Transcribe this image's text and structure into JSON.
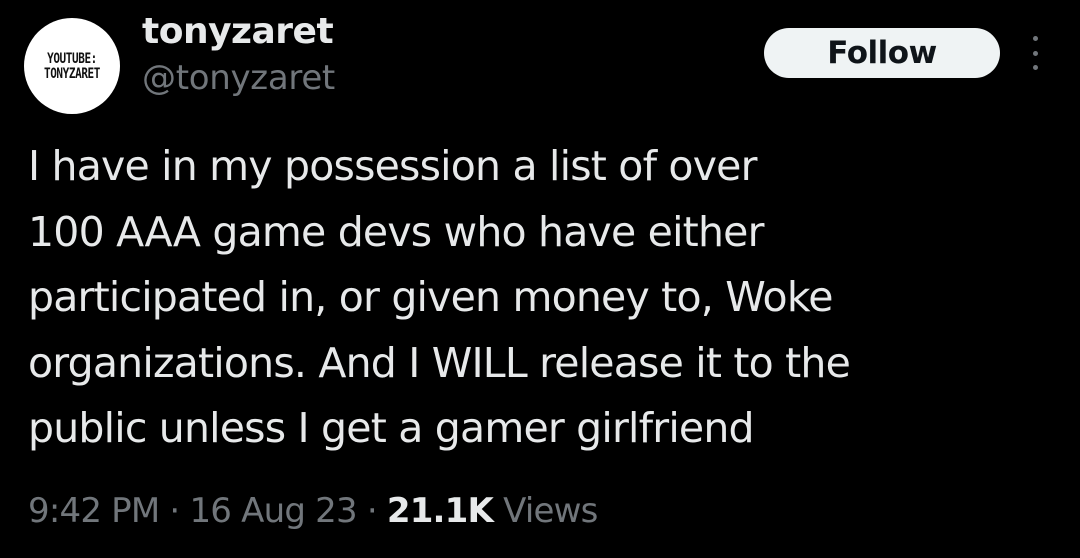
{
  "author": {
    "avatar_text": [
      "YOUTUBE:",
      "TONYZARET"
    ],
    "display_name": "tonyzaret",
    "handle": "@tonyzaret"
  },
  "actions": {
    "follow_label": "Follow",
    "more_icon": "more-vertical-icon"
  },
  "tweet": {
    "lines": [
      "I have in my possession a list of over",
      "100 AAA game devs who have either",
      "participated in, or given money to, Woke",
      "organizations. And I WILL release it to the",
      "public unless I get a gamer girlfriend"
    ]
  },
  "meta": {
    "time": "9:42 PM",
    "separator": "·",
    "date": "16 Aug 23",
    "views_count": "21.1K",
    "views_label": "Views"
  },
  "colors": {
    "background": "#000000",
    "primary_text": "#e7e9ea",
    "secondary_text": "#71767b",
    "button_bg": "#eff3f4",
    "button_text": "#0f1419"
  }
}
